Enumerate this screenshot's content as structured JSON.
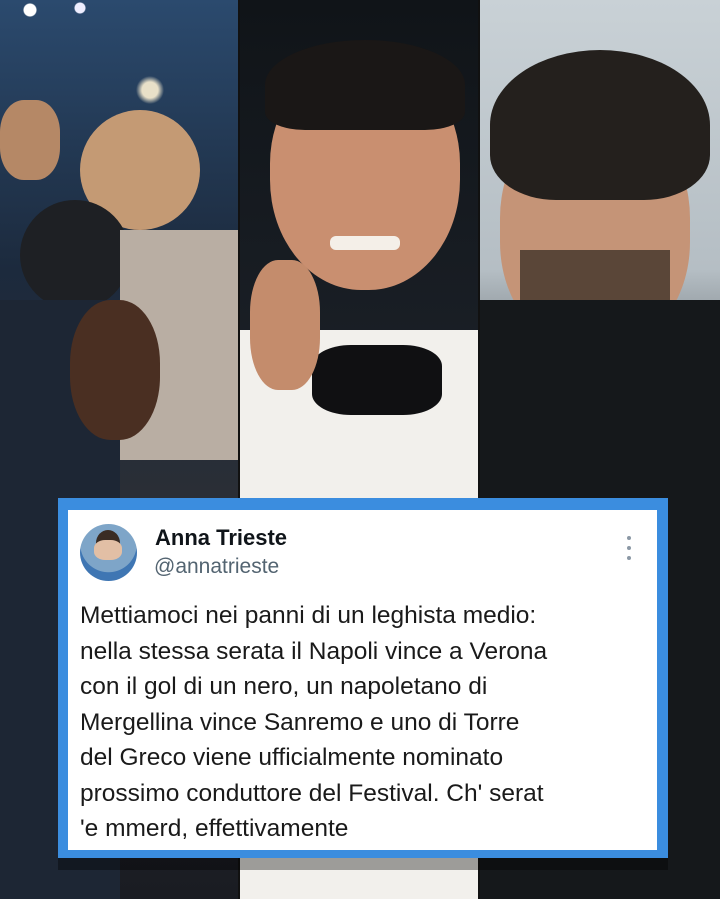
{
  "tweet": {
    "author": "Anna Trieste",
    "handle": "@annatrieste",
    "text": "Mettiamoci nei panni di un leghista medio:\nnella stessa serata il Napoli vince a Verona\ncon il gol di un nero, un napoletano di\nMergellina vince Sanremo e uno di Torre\ndel Greco viene ufficialmente nominato\nprossimo conduttore del Festival. Ch' serat\n'e mmerd, effettivamente",
    "more_icon": "more-vertical-icon"
  },
  "photos": [
    "football-celebration-photo",
    "presenter-tuxedo-photo",
    "smiling-man-photo"
  ],
  "colors": {
    "card_border": "#3b8ddf",
    "card_bg": "#ffffff",
    "handle": "#536471"
  }
}
